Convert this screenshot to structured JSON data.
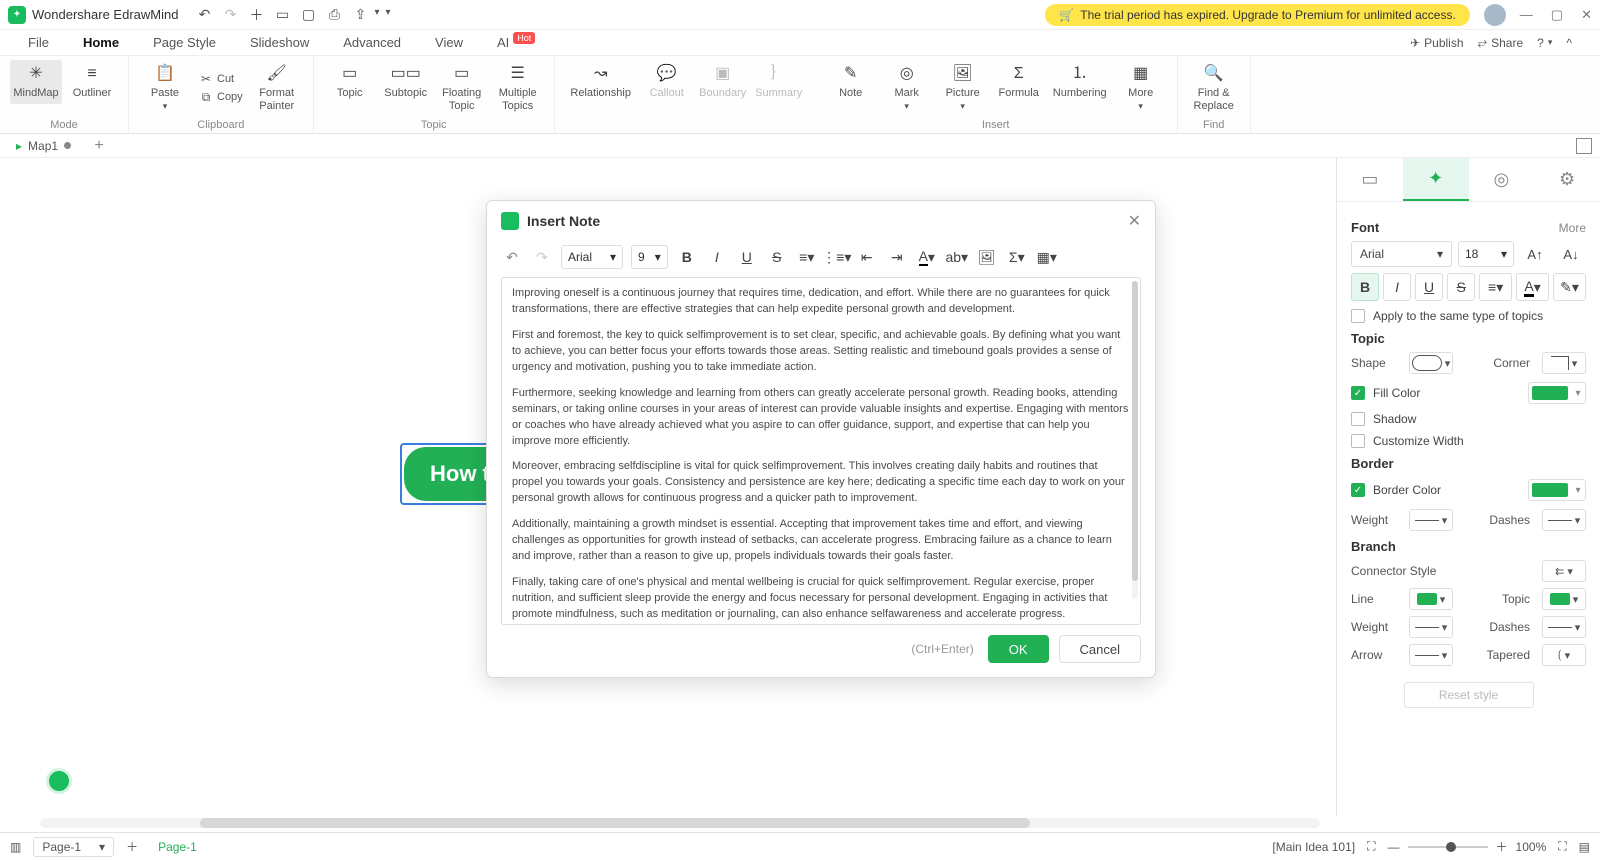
{
  "titlebar": {
    "app_name": "Wondershare EdrawMind",
    "trial_text": "The trial period has expired. Upgrade to Premium for unlimited access."
  },
  "menu": {
    "tabs": [
      "File",
      "Home",
      "Page Style",
      "Slideshow",
      "Advanced",
      "View",
      "AI"
    ],
    "ai_badge": "Hot",
    "right": {
      "publish": "Publish",
      "share": "Share"
    }
  },
  "ribbon": {
    "mode": {
      "mindmap": "MindMap",
      "outliner": "Outliner",
      "label": "Mode"
    },
    "clipboard": {
      "paste": "Paste",
      "cut": "Cut",
      "copy": "Copy",
      "fmt": "Format\nPainter",
      "label": "Clipboard"
    },
    "topic": {
      "topic": "Topic",
      "subtopic": "Subtopic",
      "floating": "Floating\nTopic",
      "multiple": "Multiple\nTopics",
      "label": "Topic"
    },
    "relation": {
      "relationship": "Relationship",
      "callout": "Callout",
      "boundary": "Boundary",
      "summary": "Summary"
    },
    "insert": {
      "note": "Note",
      "mark": "Mark",
      "picture": "Picture",
      "formula": "Formula",
      "numbering": "Numbering",
      "more": "More",
      "label": "Insert"
    },
    "find": {
      "find": "Find &\nReplace",
      "label": "Find"
    }
  },
  "doctabs": {
    "tab1": "Map1"
  },
  "canvas": {
    "node_text": "How t"
  },
  "modal": {
    "title": "Insert Note",
    "font": "Arial",
    "size": "9",
    "hint": "(Ctrl+Enter)",
    "ok": "OK",
    "cancel": "Cancel",
    "paragraphs": [
      "Improving oneself is a continuous journey that requires time, dedication, and effort. While there are no guarantees for quick transformations, there are effective strategies that can help expedite personal growth and development.",
      "First and foremost, the key to quick selfimprovement is to set clear, specific, and achievable goals. By defining what you want to achieve, you can better focus your efforts towards those areas. Setting realistic and timebound goals provides a sense of urgency and motivation, pushing you to take immediate action.",
      "Furthermore, seeking knowledge and learning from others can greatly accelerate personal growth. Reading books, attending seminars, or taking online courses in your areas of interest can provide valuable insights and expertise. Engaging with mentors or coaches who have already achieved what you aspire to can offer guidance, support, and expertise that can help you improve more efficiently.",
      "Moreover, embracing selfdiscipline is vital for quick selfimprovement. This involves creating daily habits and routines that propel you towards your goals. Consistency and persistence are key here; dedicating a specific time each day to work on your personal growth allows for continuous progress and a quicker path to improvement.",
      "Additionally, maintaining a growth mindset is essential. Accepting that improvement takes time and effort, and viewing challenges as opportunities for growth instead of setbacks, can accelerate progress. Embracing failure as a chance to learn and improve, rather than a reason to give up, propels individuals towards their goals faster.",
      "Finally, taking care of one's physical and mental wellbeing is crucial for quick selfimprovement. Regular exercise, proper nutrition, and sufficient sleep provide the energy and focus necessary for personal development. Engaging in activities that promote mindfulness, such as meditation or journaling, can also enhance selfawareness and accelerate progress."
    ]
  },
  "rp": {
    "font": {
      "title": "Font",
      "more": "More",
      "family": "Arial",
      "size": "18",
      "apply": "Apply to the same type of topics"
    },
    "topic": {
      "title": "Topic",
      "shape": "Shape",
      "corner": "Corner",
      "fill": "Fill Color",
      "shadow": "Shadow",
      "custom": "Customize Width"
    },
    "border": {
      "title": "Border",
      "color": "Border Color",
      "weight": "Weight",
      "dashes": "Dashes"
    },
    "branch": {
      "title": "Branch",
      "conn": "Connector Style",
      "line": "Line",
      "topic": "Topic",
      "weight": "Weight",
      "dashes": "Dashes",
      "arrow": "Arrow",
      "tapered": "Tapered"
    },
    "reset": "Reset style"
  },
  "status": {
    "page_sel": "Page-1",
    "page_tab": "Page-1",
    "idea": "[Main Idea 101]",
    "zoom": "100%"
  },
  "colors": {
    "accent": "#22b055"
  }
}
